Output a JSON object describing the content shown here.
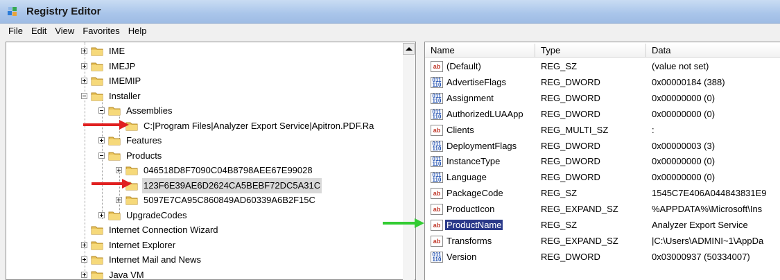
{
  "window": {
    "title": "Registry Editor",
    "app_icon": "registry-icon"
  },
  "menu": [
    "File",
    "Edit",
    "View",
    "Favorites",
    "Help"
  ],
  "tree": [
    {
      "label": "IME",
      "expander": "plus",
      "selected": false
    },
    {
      "label": "IMEJP",
      "expander": "plus",
      "selected": false
    },
    {
      "label": "IMEMIP",
      "expander": "plus",
      "selected": false
    },
    {
      "label": "Installer",
      "expander": "minus",
      "selected": false
    },
    {
      "label": "Assemblies",
      "expander": "minus",
      "selected": false
    },
    {
      "label": "C:|Program Files|Analyzer Export Service|Apitron.PDF.Ra",
      "expander": "",
      "selected": false
    },
    {
      "label": "Features",
      "expander": "plus",
      "selected": false
    },
    {
      "label": "Products",
      "expander": "minus",
      "selected": false
    },
    {
      "label": "046518D8F7090C04B8798AEE67E99028",
      "expander": "plus",
      "selected": false
    },
    {
      "label": "123F6E39AE6D2624CA5BEBF72DC5A31C",
      "expander": "",
      "selected": true
    },
    {
      "label": "5097E7CA95C860849AD60339A6B2F15C",
      "expander": "plus",
      "selected": false
    },
    {
      "label": "UpgradeCodes",
      "expander": "plus",
      "selected": false
    },
    {
      "label": "Internet Connection Wizard",
      "expander": "",
      "selected": false
    },
    {
      "label": "Internet Explorer",
      "expander": "plus",
      "selected": false
    },
    {
      "label": "Internet Mail and News",
      "expander": "plus",
      "selected": false
    },
    {
      "label": "Java VM",
      "expander": "plus",
      "selected": false
    }
  ],
  "columns": {
    "name": "Name",
    "type": "Type",
    "data": "Data"
  },
  "values": [
    {
      "icon": "string-value-icon",
      "name": "(Default)",
      "type": "REG_SZ",
      "data": "(value not set)",
      "selected": false
    },
    {
      "icon": "binary-value-icon",
      "name": "AdvertiseFlags",
      "type": "REG_DWORD",
      "data": "0x00000184 (388)",
      "selected": false
    },
    {
      "icon": "binary-value-icon",
      "name": "Assignment",
      "type": "REG_DWORD",
      "data": "0x00000000 (0)",
      "selected": false
    },
    {
      "icon": "binary-value-icon",
      "name": "AuthorizedLUAApp",
      "type": "REG_DWORD",
      "data": "0x00000000 (0)",
      "selected": false
    },
    {
      "icon": "string-value-icon",
      "name": "Clients",
      "type": "REG_MULTI_SZ",
      "data": ":",
      "selected": false
    },
    {
      "icon": "binary-value-icon",
      "name": "DeploymentFlags",
      "type": "REG_DWORD",
      "data": "0x00000003 (3)",
      "selected": false
    },
    {
      "icon": "binary-value-icon",
      "name": "InstanceType",
      "type": "REG_DWORD",
      "data": "0x00000000 (0)",
      "selected": false
    },
    {
      "icon": "binary-value-icon",
      "name": "Language",
      "type": "REG_DWORD",
      "data": "0x00000000 (0)",
      "selected": false
    },
    {
      "icon": "string-value-icon",
      "name": "PackageCode",
      "type": "REG_SZ",
      "data": "1545C7E406A044843831E9",
      "selected": false
    },
    {
      "icon": "string-value-icon",
      "name": "ProductIcon",
      "type": "REG_EXPAND_SZ",
      "data": "%APPDATA%\\Microsoft\\Ins",
      "selected": false
    },
    {
      "icon": "string-value-icon",
      "name": "ProductName",
      "type": "REG_SZ",
      "data": "Analyzer Export Service",
      "selected": true
    },
    {
      "icon": "string-value-icon",
      "name": "Transforms",
      "type": "REG_EXPAND_SZ",
      "data": "|C:\\Users\\ADMINI~1\\AppDa",
      "selected": false
    },
    {
      "icon": "binary-value-icon",
      "name": "Version",
      "type": "REG_DWORD",
      "data": "0x03000937 (50334007)",
      "selected": false
    }
  ],
  "icon_text": {
    "string": "ab",
    "binary": "011\n110"
  },
  "colors": {
    "annotation_red": "#e02020",
    "annotation_green": "#33cc33",
    "selection": "#2b3a8a"
  }
}
